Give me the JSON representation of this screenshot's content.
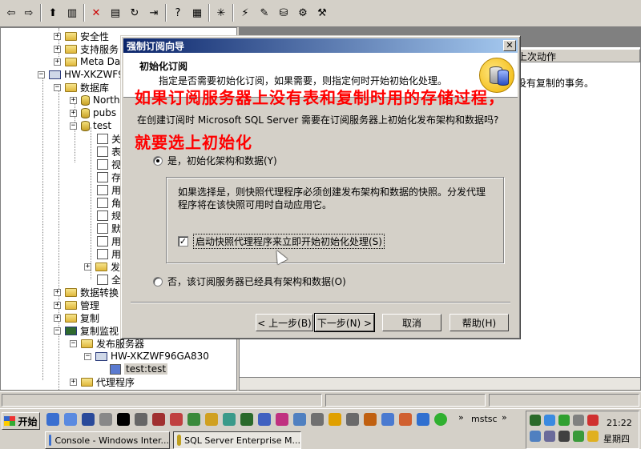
{
  "tree": {
    "items": [
      {
        "label": "安全性",
        "icon": "folder"
      },
      {
        "label": "支持服务",
        "icon": "folder"
      },
      {
        "label": "Meta Data",
        "icon": "folder"
      },
      {
        "label": "HW-XKZWF96",
        "icon": "server"
      },
      {
        "label": "数据库",
        "icon": "folder"
      },
      {
        "label": "North",
        "icon": "database"
      },
      {
        "label": "pubs",
        "icon": "database"
      },
      {
        "label": "test",
        "icon": "database"
      },
      {
        "label": "关",
        "icon": "diagram"
      },
      {
        "label": "表",
        "icon": "table"
      },
      {
        "label": "视",
        "icon": "view"
      },
      {
        "label": "存",
        "icon": "stored-procedure"
      },
      {
        "label": "用",
        "icon": "user"
      },
      {
        "label": "角",
        "icon": "role"
      },
      {
        "label": "规",
        "icon": "rule"
      },
      {
        "label": "默",
        "icon": "default"
      },
      {
        "label": "用",
        "icon": "user-defined-type"
      },
      {
        "label": "用",
        "icon": "user-defined-function"
      },
      {
        "label": "发",
        "icon": "folder"
      },
      {
        "label": "全",
        "icon": "fulltext"
      },
      {
        "label": "数据转换",
        "icon": "folder"
      },
      {
        "label": "管理",
        "icon": "folder"
      },
      {
        "label": "复制",
        "icon": "folder"
      },
      {
        "label": "复制监视",
        "icon": "monitor"
      },
      {
        "label": "发布服务器",
        "icon": "folder"
      },
      {
        "label": "HW-XKZWF96GA830",
        "icon": "server"
      },
      {
        "label": "test:test",
        "icon": "publication"
      },
      {
        "label": "代理程序",
        "icon": "folder"
      }
    ]
  },
  "right_pane": {
    "column_header": "上次动作",
    "row_text": "没有复制的事务。"
  },
  "dialog": {
    "title": "强制订阅向导",
    "close_label": "✕",
    "header_title": "初始化订阅",
    "header_desc": "指定是否需要初始化订阅，如果需要，则指定何时开始初始化处理。",
    "question": "在创建订阅时 Microsoft SQL Server 需要在订阅服务器上初始化发布架构和数据吗?",
    "option_yes": "是，初始化架构和数据(Y)",
    "group_desc": "如果选择是，则快照代理程序必须创建发布架构和数据的快照。分发代理程序将在该快照可用时自动应用它。",
    "checkbox_label": "启动快照代理程序来立即开始初始化处理(S)",
    "checkbox_checked": true,
    "option_no": "否，该订阅服务器已经具有架构和数据(O)",
    "buttons": {
      "back": "< 上一步(B)",
      "next": "下一步(N) >",
      "cancel": "取消",
      "help": "帮助(H)"
    }
  },
  "annotations": {
    "line1": "如果订阅服务器上没有表和复制时用的存储过程，",
    "line2": "就要选上初始化"
  },
  "taskbar": {
    "start_label": "开始",
    "mstsc_label": "mstsc",
    "tasks": [
      {
        "label": "Console - Windows Inter..."
      },
      {
        "label": "SQL Server Enterprise M..."
      }
    ],
    "clock_time": "21:22",
    "clock_day": "星期四"
  }
}
